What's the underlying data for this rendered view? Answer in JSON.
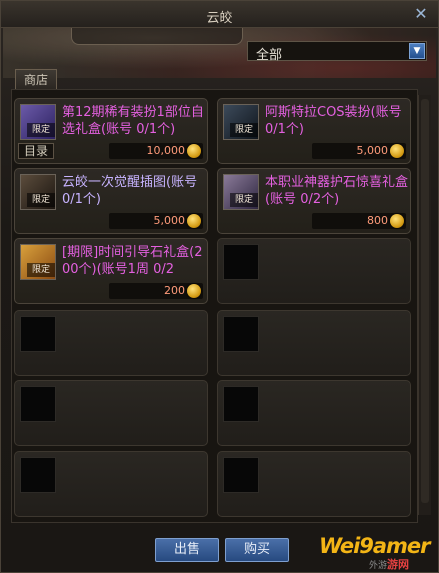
{
  "window": {
    "title": "云皎",
    "close_glyph": "✕"
  },
  "filter": {
    "selected": "全部",
    "arrow_glyph": "▼"
  },
  "tabs": [
    {
      "label": "商店"
    }
  ],
  "items": [
    {
      "name": "第12期稀有装扮1部位自选礼盒(账号 0/1个)",
      "price": "10,000",
      "badge": "限定",
      "catalog_label": "目录",
      "icon": "purple-gift-box-icon",
      "color": "#e460e0"
    },
    {
      "name": "阿斯特拉COS装扮(账号 0/1个)",
      "price": "5,000",
      "badge": "限定",
      "icon": "sword-costume-icon",
      "color": "#e460e0"
    },
    {
      "name": "云皎一次觉醒插图(账号 0/1个)",
      "price": "5,000",
      "badge": "限定",
      "icon": "awakening-illustration-icon",
      "color": "#c7b3ff"
    },
    {
      "name": "本职业神器护石惊喜礼盒(账号 0/2个)",
      "price": "800",
      "badge": "限定",
      "icon": "artifact-stone-box-icon",
      "color": "#e460e0"
    },
    {
      "name": "[期限]时间引导石礼盒(200个)(账号1周 0/2",
      "price": "200",
      "badge": "限定",
      "icon": "golden-gift-box-icon",
      "color": "#e460e0"
    }
  ],
  "buttons": {
    "sell": "出售",
    "buy": "购买"
  },
  "watermark": {
    "brand": "Wei9amer",
    "sub": "外游",
    "site": "游网"
  }
}
